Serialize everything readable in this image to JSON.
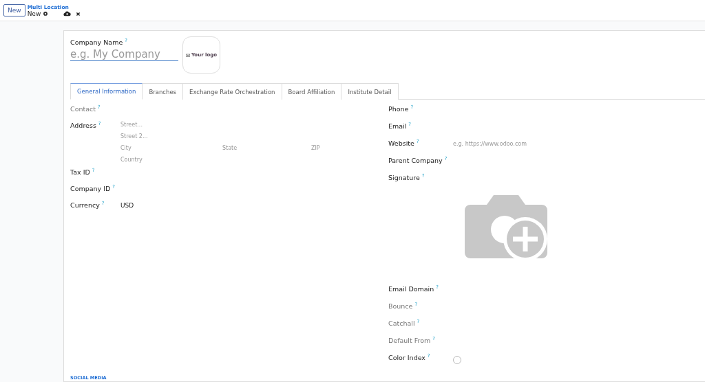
{
  "control_panel": {
    "new_button": "New",
    "breadcrumb": "Multi Location",
    "record": "New"
  },
  "form": {
    "name_label": "Company Name",
    "name_placeholder": "e.g. My Company",
    "logo_label": "Your logo",
    "tabs": [
      {
        "label": "General Information",
        "selected": true
      },
      {
        "label": "Branches",
        "selected": false
      },
      {
        "label": "Exchange Rate Orchestration",
        "selected": false
      },
      {
        "label": "Board Affiliation",
        "selected": false
      },
      {
        "label": "Institute Detail",
        "selected": false
      }
    ],
    "left_fields": [
      {
        "kind": "text",
        "label": "Contact",
        "muted": true
      },
      {
        "kind": "address",
        "label": "Address",
        "muted": false,
        "street": "Street...",
        "street2": "Street 2...",
        "city": "City",
        "state": "State",
        "zip": "ZIP",
        "country": "Country"
      },
      {
        "kind": "text",
        "label": "Tax ID",
        "muted": false
      },
      {
        "kind": "text",
        "label": "Company ID",
        "muted": false
      },
      {
        "kind": "value",
        "label": "Currency",
        "muted": false,
        "value": "USD"
      }
    ],
    "right_fields": [
      {
        "kind": "text",
        "label": "Phone",
        "muted": false
      },
      {
        "kind": "text",
        "label": "Email",
        "muted": false
      },
      {
        "kind": "placeholder",
        "label": "Website",
        "muted": false,
        "placeholder": "e.g. https://www.odoo.com"
      },
      {
        "kind": "text",
        "label": "Parent Company",
        "muted": false
      },
      {
        "kind": "image",
        "label": "Signature",
        "muted": false
      },
      {
        "kind": "text",
        "label": "Email Domain",
        "muted": false
      },
      {
        "kind": "text",
        "label": "Bounce",
        "muted": true
      },
      {
        "kind": "text",
        "label": "Catchall",
        "muted": true
      },
      {
        "kind": "text",
        "label": "Default From",
        "muted": true
      },
      {
        "kind": "color",
        "label": "Color Index",
        "muted": false
      }
    ],
    "help_mark": "?",
    "section_title": "SOCIAL MEDIA"
  }
}
